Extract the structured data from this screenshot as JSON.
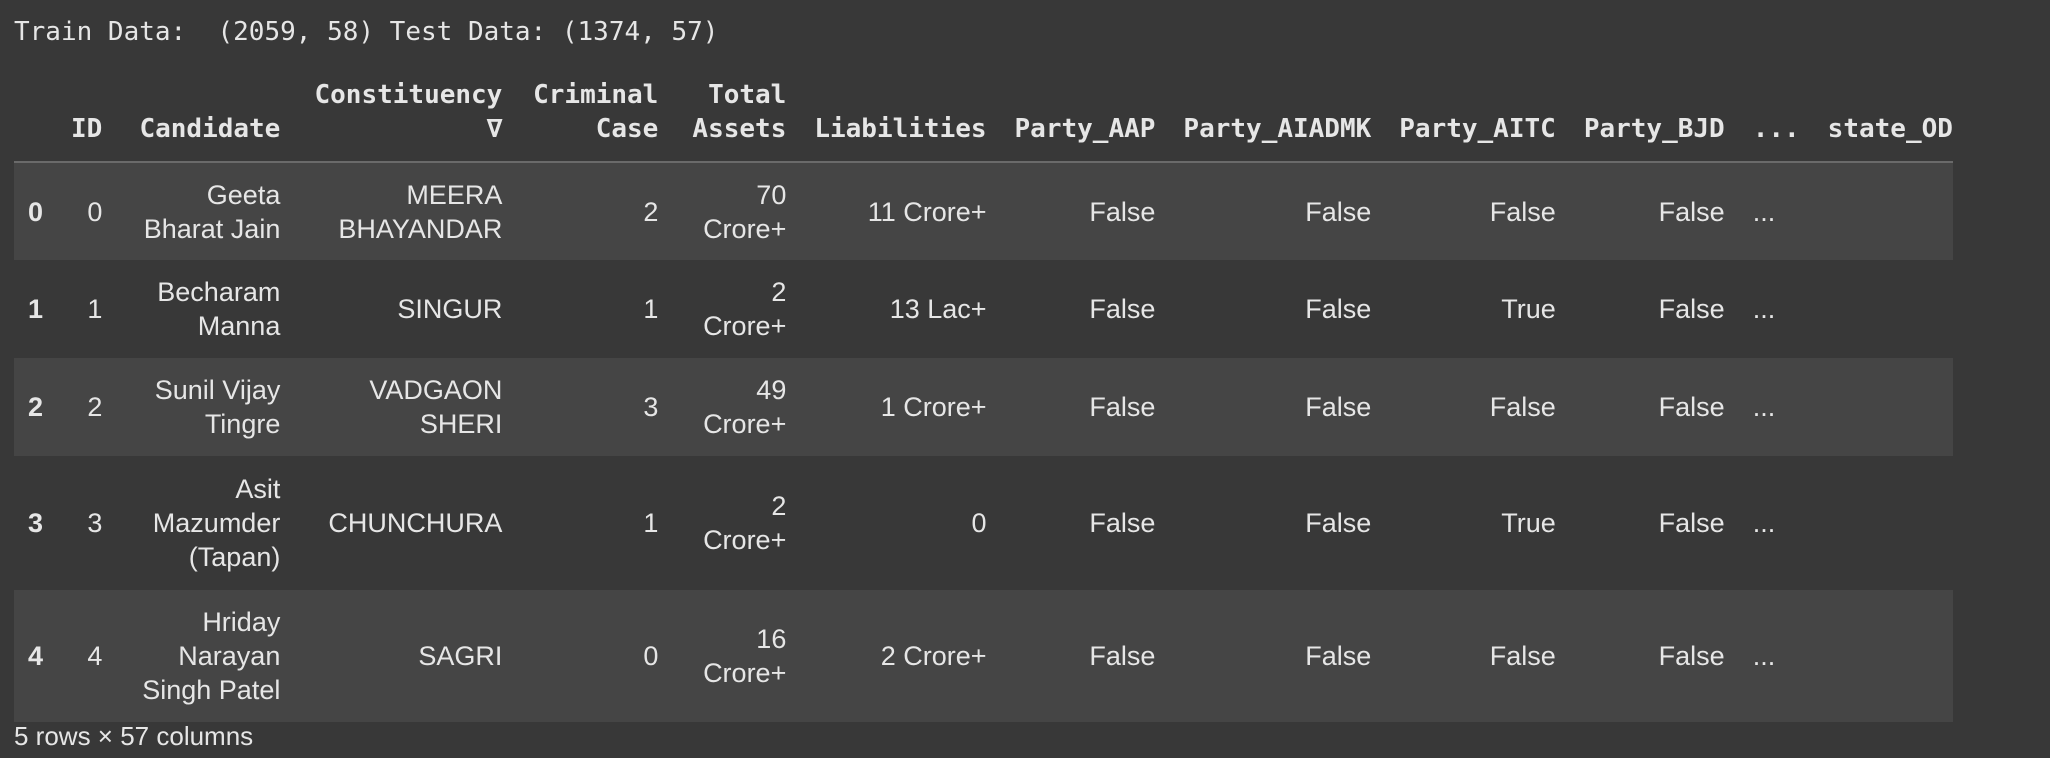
{
  "output_line": "Train Data:  (2059, 58) Test Data: (1374, 57)",
  "columns": {
    "index": "",
    "id": "ID",
    "candidate": "Candidate",
    "constituency": "Constituency ∇",
    "criminal_case": "Criminal Case",
    "total_assets": "Total Assets",
    "liabilities": "Liabilities",
    "party_aap": "Party_AAP",
    "party_aiadmk": "Party_AIADMK",
    "party_aitc": "Party_AITC",
    "party_bjd": "Party_BJD",
    "ellipsis": "...",
    "state_od": "state_OD"
  },
  "rows": [
    {
      "index": "0",
      "id": "0",
      "candidate": "Geeta Bharat Jain",
      "constituency": "MEERA BHAYANDAR",
      "criminal_case": "2",
      "total_assets": "70 Crore+",
      "liabilities": "11 Crore+",
      "party_aap": "False",
      "party_aiadmk": "False",
      "party_aitc": "False",
      "party_bjd": "False",
      "ellipsis": "..."
    },
    {
      "index": "1",
      "id": "1",
      "candidate": "Becharam Manna",
      "constituency": "SINGUR",
      "criminal_case": "1",
      "total_assets": "2 Crore+",
      "liabilities": "13 Lac+",
      "party_aap": "False",
      "party_aiadmk": "False",
      "party_aitc": "True",
      "party_bjd": "False",
      "ellipsis": "..."
    },
    {
      "index": "2",
      "id": "2",
      "candidate": "Sunil Vijay Tingre",
      "constituency": "VADGAON SHERI",
      "criminal_case": "3",
      "total_assets": "49 Crore+",
      "liabilities": "1 Crore+",
      "party_aap": "False",
      "party_aiadmk": "False",
      "party_aitc": "False",
      "party_bjd": "False",
      "ellipsis": "..."
    },
    {
      "index": "3",
      "id": "3",
      "candidate": "Asit Mazumder (Tapan)",
      "constituency": "CHUNCHURA",
      "criminal_case": "1",
      "total_assets": "2 Crore+",
      "liabilities": "0",
      "party_aap": "False",
      "party_aiadmk": "False",
      "party_aitc": "True",
      "party_bjd": "False",
      "ellipsis": "..."
    },
    {
      "index": "4",
      "id": "4",
      "candidate": "Hriday Narayan Singh Patel",
      "constituency": "SAGRI",
      "criminal_case": "0",
      "total_assets": "16 Crore+",
      "liabilities": "2 Crore+",
      "party_aap": "False",
      "party_aiadmk": "False",
      "party_aitc": "False",
      "party_bjd": "False",
      "ellipsis": "..."
    }
  ],
  "footer": "5 rows × 57 columns"
}
